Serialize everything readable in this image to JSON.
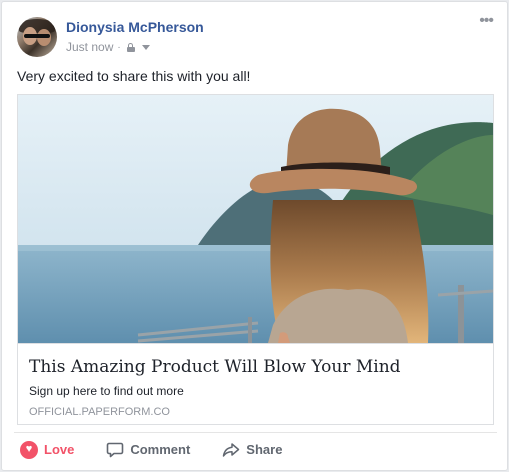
{
  "post": {
    "author": "Dionysia McPherson",
    "timestamp": "Just now",
    "separator": "·",
    "more_icon": "more-horizontal-icon",
    "privacy_icon": "lock-icon",
    "message": "Very excited to share this with you all!"
  },
  "link_preview": {
    "title": "This Amazing Product Will Blow Your Mind",
    "description": "Sign up here to find out more",
    "domain": "OFFICIAL.PAPERFORM.CO"
  },
  "actions": [
    {
      "label": "Love",
      "icon": "heart-icon",
      "color": "#f25268"
    },
    {
      "label": "Comment",
      "icon": "comment-icon"
    },
    {
      "label": "Share",
      "icon": "share-icon"
    }
  ],
  "colors": {
    "author_link": "#365899",
    "love_accent": "#f25268",
    "muted": "#90949c"
  }
}
